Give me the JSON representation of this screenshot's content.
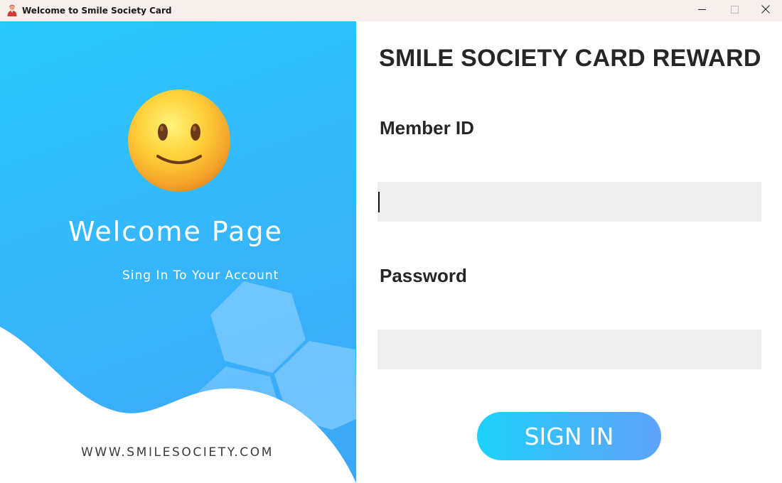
{
  "window": {
    "title": "Welcome to Smile Society Card",
    "icon": "user-icon",
    "controls": [
      "minimize-icon",
      "maximize-icon",
      "close-icon"
    ]
  },
  "left_panel": {
    "emoji": "smiling-face-icon",
    "title": "Welcome Page",
    "subtitle": "Sing In To Your Account",
    "website": "WWW.SMILESOCIETY.COM"
  },
  "form": {
    "heading": "SMILE SOCIETY CARD REWARD",
    "member_id_label": "Member ID",
    "member_id_value": "",
    "password_label": "Password",
    "password_value": "",
    "signin_label": "SIGN IN"
  },
  "colors": {
    "gradient_start": "#2ac8ff",
    "gradient_end": "#3ea6f6",
    "field_bg": "#eeeeee",
    "button_start": "#1bd2fc",
    "button_end": "#5ea3fb",
    "text_dark": "#262626"
  }
}
